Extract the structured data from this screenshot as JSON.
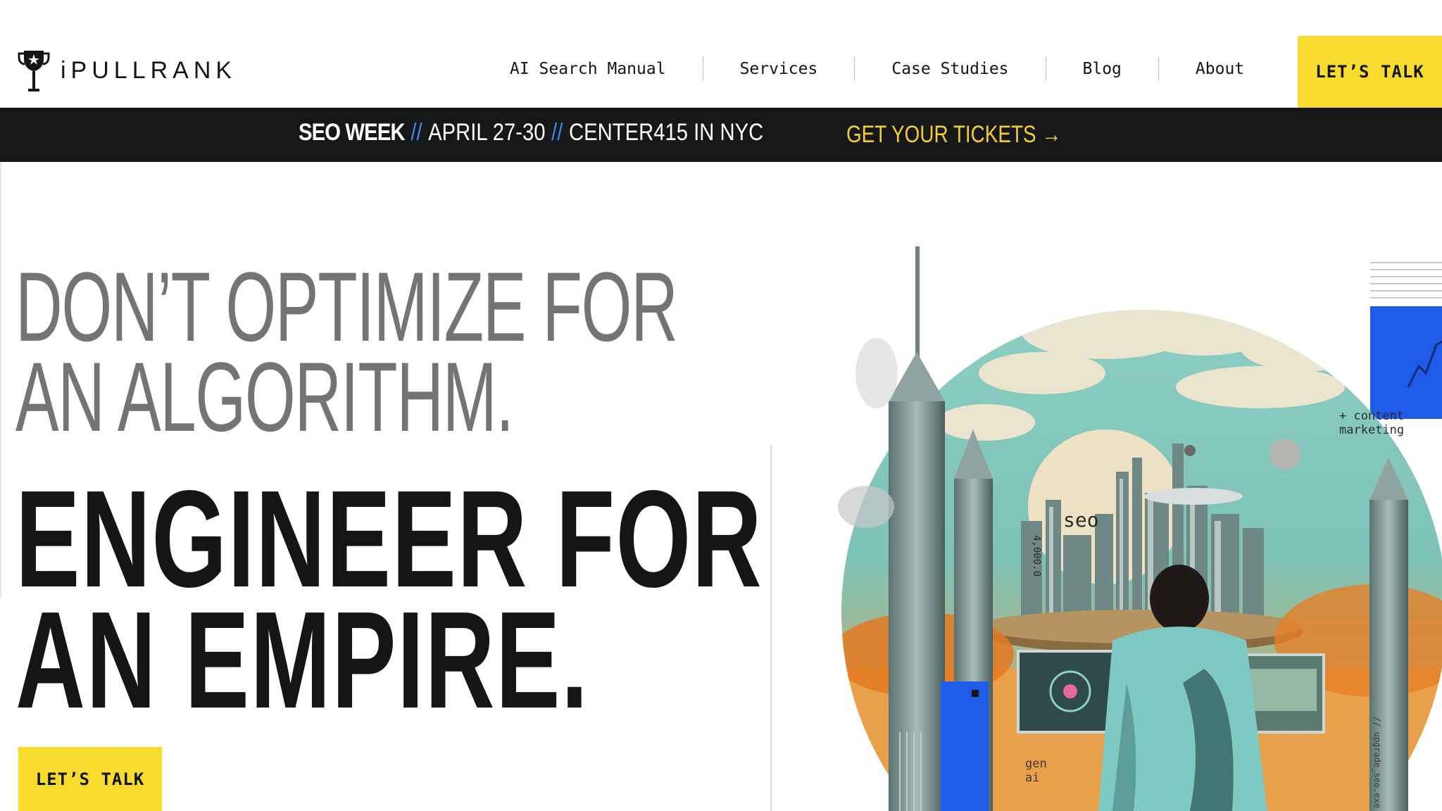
{
  "header": {
    "logo_text": "iPULLRANK",
    "nav": [
      {
        "label": "AI Search Manual"
      },
      {
        "label": "Services"
      },
      {
        "label": "Case Studies"
      },
      {
        "label": "Blog"
      },
      {
        "label": "About"
      }
    ],
    "cta_label": "LET’S TALK"
  },
  "banner": {
    "event_name": "SEO WEEK",
    "separator": "//",
    "dates": "APRIL 27-30",
    "venue": "CENTER415 IN NYC",
    "tickets_label": "GET YOUR TICKETS →"
  },
  "hero": {
    "headline_light_1": "DON’T OPTIMIZE FOR",
    "headline_light_2": "AN ALGORITHM.",
    "headline_bold_1": "ENGINEER FOR",
    "headline_bold_2": "AN EMPIRE.",
    "cta_label": "LET’S TALK"
  },
  "illustration": {
    "label_content": "+ content",
    "label_marketing": "marketing",
    "label_seo": "seo",
    "label_number": "4,000.0",
    "label_gen": "gen",
    "label_ai": "ai",
    "label_upgrade": "// upgrade_seo.exe"
  },
  "colors": {
    "accent_yellow": "#f7dc2f",
    "banner_bg": "#161719",
    "banner_slash": "#3a8df0",
    "tickets_yellow": "#f4cf30",
    "art_blue": "#1f5ae8",
    "sky_teal": "#7fc7bd",
    "sand_orange": "#e88a2e"
  },
  "icons": {
    "logo": "trophy-icon"
  }
}
